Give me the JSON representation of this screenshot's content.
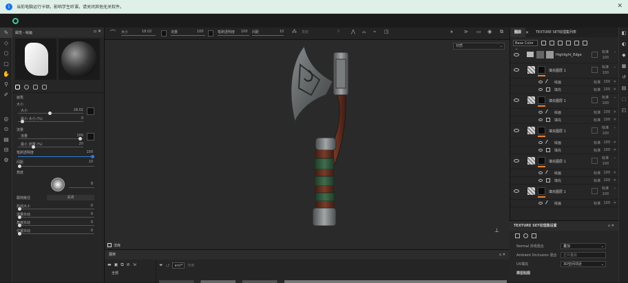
{
  "notification": {
    "text": "当前电脑运行卡顿，影响学生听课，请关闭其他无关软件。",
    "close": "✕"
  },
  "left_panel": {
    "header": "属性 - 绘画",
    "section_brush": "画笔",
    "size_label": "大小",
    "size_sub": "大小",
    "size_value": "18.02",
    "min_size_label": "最小 大小 (%)",
    "min_size_value": "0",
    "flow_section": "流量",
    "flow_label": "流量",
    "flow_value": "100",
    "min_flow_label": "最小 流量 (%)",
    "min_flow_value": "20",
    "opacity_label": "笔刷透明度",
    "opacity_value": "100",
    "spacing_label": "间距",
    "spacing_value": "10",
    "angle_label": "角度",
    "angle_value": "0",
    "follow_path_label": "跟随路径",
    "follow_path_value": "关闭",
    "jitter_size_label": "抖动大小",
    "jitter_size_value": "0",
    "jitter_flow_label": "流量抖动",
    "jitter_flow_value": "0",
    "jitter_angle_label": "角度抖动",
    "jitter_angle_value": "0",
    "jitter_pos_label": "位置抖动",
    "jitter_pos_value": "0"
  },
  "toolbar": {
    "size_label": "大小",
    "size_value": "18.02",
    "flow_label": "流量",
    "flow_value": "100",
    "opacity_label": "笔刷透明度",
    "opacity_value": "100",
    "spacing_label": "间距",
    "spacing_value": "10",
    "angle_label": "角度",
    "angle_value": "0"
  },
  "viewport": {
    "material_dropdown": "材质",
    "bottom_label": "法库"
  },
  "shelf": {
    "title": "展架",
    "search_label": "arol*",
    "search_placeholder": "搜索",
    "tree_item": "全部"
  },
  "layers": {
    "tab_active": "图层",
    "tab_other": "TEXTURE SET纹理集列表",
    "channel_select": "Base Color",
    "rows": [
      {
        "name": "Highlight_Edge",
        "blend": "标准",
        "opacity": "100",
        "type": "folder"
      },
      {
        "name": "填充图层 1",
        "blend": "标准",
        "opacity": "100",
        "type": "fill",
        "subs": [
          {
            "name": "绘画",
            "blend": "标准",
            "opacity": "100"
          },
          {
            "name": "填充",
            "blend": "标准",
            "opacity": "100"
          }
        ]
      },
      {
        "name": "填充图层 1",
        "blend": "标准",
        "opacity": "100",
        "type": "fill",
        "subs": [
          {
            "name": "绘画",
            "blend": "标准",
            "opacity": "100"
          },
          {
            "name": "填充",
            "blend": "标准",
            "opacity": "100"
          }
        ]
      },
      {
        "name": "填充图层 1",
        "blend": "标准",
        "opacity": "100",
        "type": "fill",
        "subs": [
          {
            "name": "绘画",
            "blend": "标准",
            "opacity": "100"
          },
          {
            "name": "填充",
            "blend": "标准",
            "opacity": "100"
          }
        ]
      },
      {
        "name": "填充图层 1",
        "blend": "标准",
        "opacity": "100",
        "type": "fill",
        "subs": [
          {
            "name": "绘画",
            "blend": "标准",
            "opacity": "100"
          },
          {
            "name": "填充",
            "blend": "标准",
            "opacity": "100"
          }
        ]
      },
      {
        "name": "填充图层 1",
        "blend": "标准",
        "opacity": "100",
        "type": "fill",
        "subs": [
          {
            "name": "绘画",
            "blend": "标准",
            "opacity": "100"
          }
        ]
      }
    ]
  },
  "texture_settings": {
    "title": "TEXTURE SET纹理集设置",
    "normal_label": "Normal 法线混合",
    "normal_value": "叠加",
    "ao_label": "Ambient Occlusion 混合",
    "ao_value": "正片叠底",
    "uv_label": "UV填充",
    "uv_value": "3D空间邻近",
    "bake_label": "模型贴图"
  },
  "colors": {
    "accent": "#f0802d",
    "logo": "#41c9a0",
    "notification_bg": "#dff0e8"
  }
}
